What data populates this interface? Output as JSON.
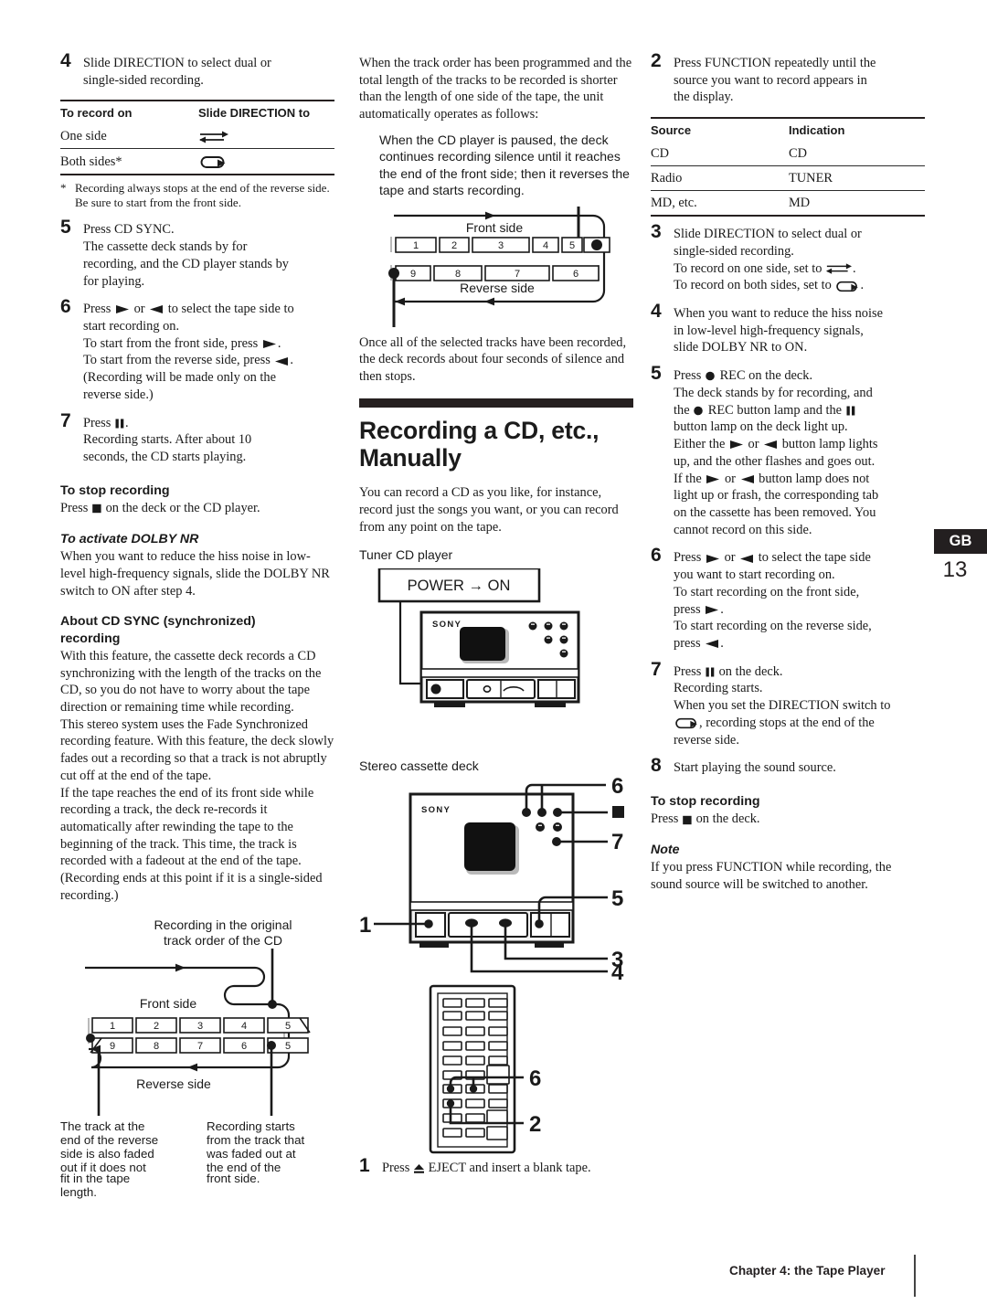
{
  "page": {
    "language_tab": "GB",
    "page_number": "13",
    "footer": "Chapter 4: the Tape Player"
  },
  "column1": {
    "step4": {
      "num": "4",
      "lines": [
        "Slide DIRECTION to select dual or",
        "single-sided recording."
      ]
    },
    "direction_table": {
      "headers": [
        "To record on",
        "Slide DIRECTION to"
      ],
      "rows": [
        {
          "label": "One side",
          "icon": "direction-one-side-icon"
        },
        {
          "label": "Both sides*",
          "icon": "direction-both-sides-icon"
        }
      ]
    },
    "footnote": {
      "marker": "*",
      "text": "Recording always stops at the end of the reverse side.  Be sure to start from the front side."
    },
    "step5": {
      "num": "5",
      "lines": [
        "Press CD SYNC.",
        "The cassette deck stands by for",
        "recording, and the CD player stands by",
        "for playing."
      ]
    },
    "step6": {
      "num": "6",
      "line1_a": "Press ",
      "line1_b": " or ",
      "line1_c": " to select the tape side to",
      "line2": "start recording on.",
      "line3_a": "To start from the front side, press ",
      "line3_b": ".",
      "line4_a": "To start from the reverse side, press ",
      "line4_b": ".",
      "line5": "(Recording will be made only on the",
      "line6": "reverse side.)"
    },
    "step7": {
      "num": "7",
      "line1_a": "Press ",
      "line1_b": ".",
      "line2": "Recording starts.  After about 10",
      "line3": "seconds, the CD starts playing."
    },
    "stop_recording": {
      "heading": "To stop recording",
      "text_a": "Press ",
      "text_b": " on the deck or the CD player."
    },
    "dolby": {
      "heading": "To activate DOLBY NR",
      "text": "When you want to reduce the hiss noise in low-level high-frequency signals, slide the DOLBY NR switch to ON after step 4."
    },
    "cdsync": {
      "heading_line1": "About CD SYNC (synchronized)",
      "heading_line2": "recording",
      "para1": "With this feature, the cassette deck records a CD synchronizing with the length of the tracks on the CD, so you do not have to worry about the tape direction or remaining time while recording.",
      "para2": "This stereo system uses the Fade Synchronized recording feature.  With this feature, the deck slowly fades out a recording so that a track is not abruptly cut off at the end of the tape.",
      "para3": "If the tape reaches the end of its front side while recording a track, the deck re-records it automatically after rewinding the tape to the beginning of the track.  This time, the track is recorded with a fadeout at the end of the tape.  (Recording ends at this point if it is a single-sided recording.)"
    },
    "diagram": {
      "caption_line1": "Recording in the original",
      "caption_line2": "track order of the CD",
      "front_label": "Front side",
      "reverse_label": "Reverse side",
      "front_tracks": [
        "1",
        "2",
        "3",
        "4",
        "5"
      ],
      "reverse_tracks": [
        "9",
        "8",
        "7",
        "6",
        "5"
      ],
      "note_left": "The track at the end of the reverse side is also faded out if it does not fit in the tape length.",
      "note_right": "Recording starts from the track that was faded out at the end of the front side."
    }
  },
  "column2": {
    "intro_para": "When the track order has been programmed and the total length of the tracks to be recorded is shorter than the length of one side of the tape, the unit automatically operates as follows:",
    "indent_para": "When the CD player is paused, the deck continues recording silence until it reaches the end of the front side; then it reverses the tape and starts recording.",
    "diagram": {
      "front_label": "Front side",
      "reverse_label": "Reverse side",
      "front_tracks": [
        "1",
        "2",
        "3",
        "4",
        "5"
      ],
      "reverse_tracks": [
        "9",
        "8",
        "7",
        "6"
      ]
    },
    "after_diagram_para": "Once all of the selected tracks have been recorded, the deck records about four seconds of silence and then stops.",
    "section_title_line1": "Recording a CD, etc.,",
    "section_title_line2": "Manually",
    "section_para": "You can record a CD as you like, for instance, record just the songs you want, or you can record from any point on the tape.",
    "tuner_label": "Tuner CD player",
    "power_box": "POWER → ON",
    "deck_label": "Stereo cassette deck",
    "brand": "SONY",
    "callouts": {
      "deck_6": "6",
      "deck_stop_icon": "stop-square-icon",
      "deck_7": "7",
      "deck_5": "5",
      "deck_1": "1",
      "deck_3": "3",
      "deck_4": "4",
      "remote_6": "6",
      "remote_2": "2"
    },
    "step1": {
      "num": "1",
      "text_a": "Press ",
      "text_b": " EJECT and insert a blank tape."
    }
  },
  "column3": {
    "step2": {
      "num": "2",
      "lines": [
        "Press FUNCTION repeatedly until the",
        "source you want to record appears in",
        "the display."
      ]
    },
    "source_table": {
      "headers": [
        "Source",
        "Indication"
      ],
      "rows": [
        [
          "CD",
          "CD"
        ],
        [
          "Radio",
          "TUNER"
        ],
        [
          "MD, etc.",
          "MD"
        ]
      ]
    },
    "step3": {
      "num": "3",
      "line1": "Slide DIRECTION to select dual or",
      "line2": "single-sided recording.",
      "line3_a": "To record on one side, set to ",
      "line3_b": ".",
      "line4_a": "To record on both sides, set to ",
      "line4_b": "."
    },
    "step4": {
      "num": "4",
      "lines": [
        "When you want to reduce the hiss noise",
        "in low-level high-frequency signals,",
        "slide DOLBY NR to ON."
      ]
    },
    "step5": {
      "num": "5",
      "l1_a": "Press ",
      "l1_b": " REC on the deck.",
      "l2": "The deck stands by for recording, and",
      "l3_a": "the ",
      "l3_b": " REC button lamp and the ",
      "l4": "button lamp on the deck light up.",
      "l5_a": "Either the ",
      "l5_b": " or ",
      "l5_c": " button lamp lights",
      "l6": "up, and the other flashes and goes out.",
      "l7_a": "If the ",
      "l7_b": " or ",
      "l7_c": " button lamp does not",
      "l8": "light up or frash, the corresponding tab",
      "l9": "on the cassette has been removed. You",
      "l10": "cannot record on this side."
    },
    "step6": {
      "num": "6",
      "l1_a": "Press ",
      "l1_b": " or ",
      "l1_c": " to select the tape side",
      "l2": "you want to start recording on.",
      "l3": "To start recording on the front side,",
      "l4_a": "press ",
      "l4_b": ".",
      "l5": "To start recording on the reverse side,",
      "l6_a": "press ",
      "l6_b": "."
    },
    "step7": {
      "num": "7",
      "l1_a": "Press ",
      "l1_b": " on the deck.",
      "l2": "Recording starts.",
      "l3": "When you set the DIRECTION switch to",
      "l4_a": ", recording stops at the end of the",
      "l5": "reverse side."
    },
    "step8": {
      "num": "8",
      "line": "Start playing the sound source."
    },
    "stop_recording": {
      "heading": "To stop recording",
      "text_a": "Press ",
      "text_b": " on the deck."
    },
    "note": {
      "heading": "Note",
      "text": "If you press FUNCTION while recording, the sound source will be switched to another."
    }
  },
  "colors": {
    "ink": "#1a1a1a",
    "rule": "#262020",
    "tab_bg": "#231f20"
  }
}
